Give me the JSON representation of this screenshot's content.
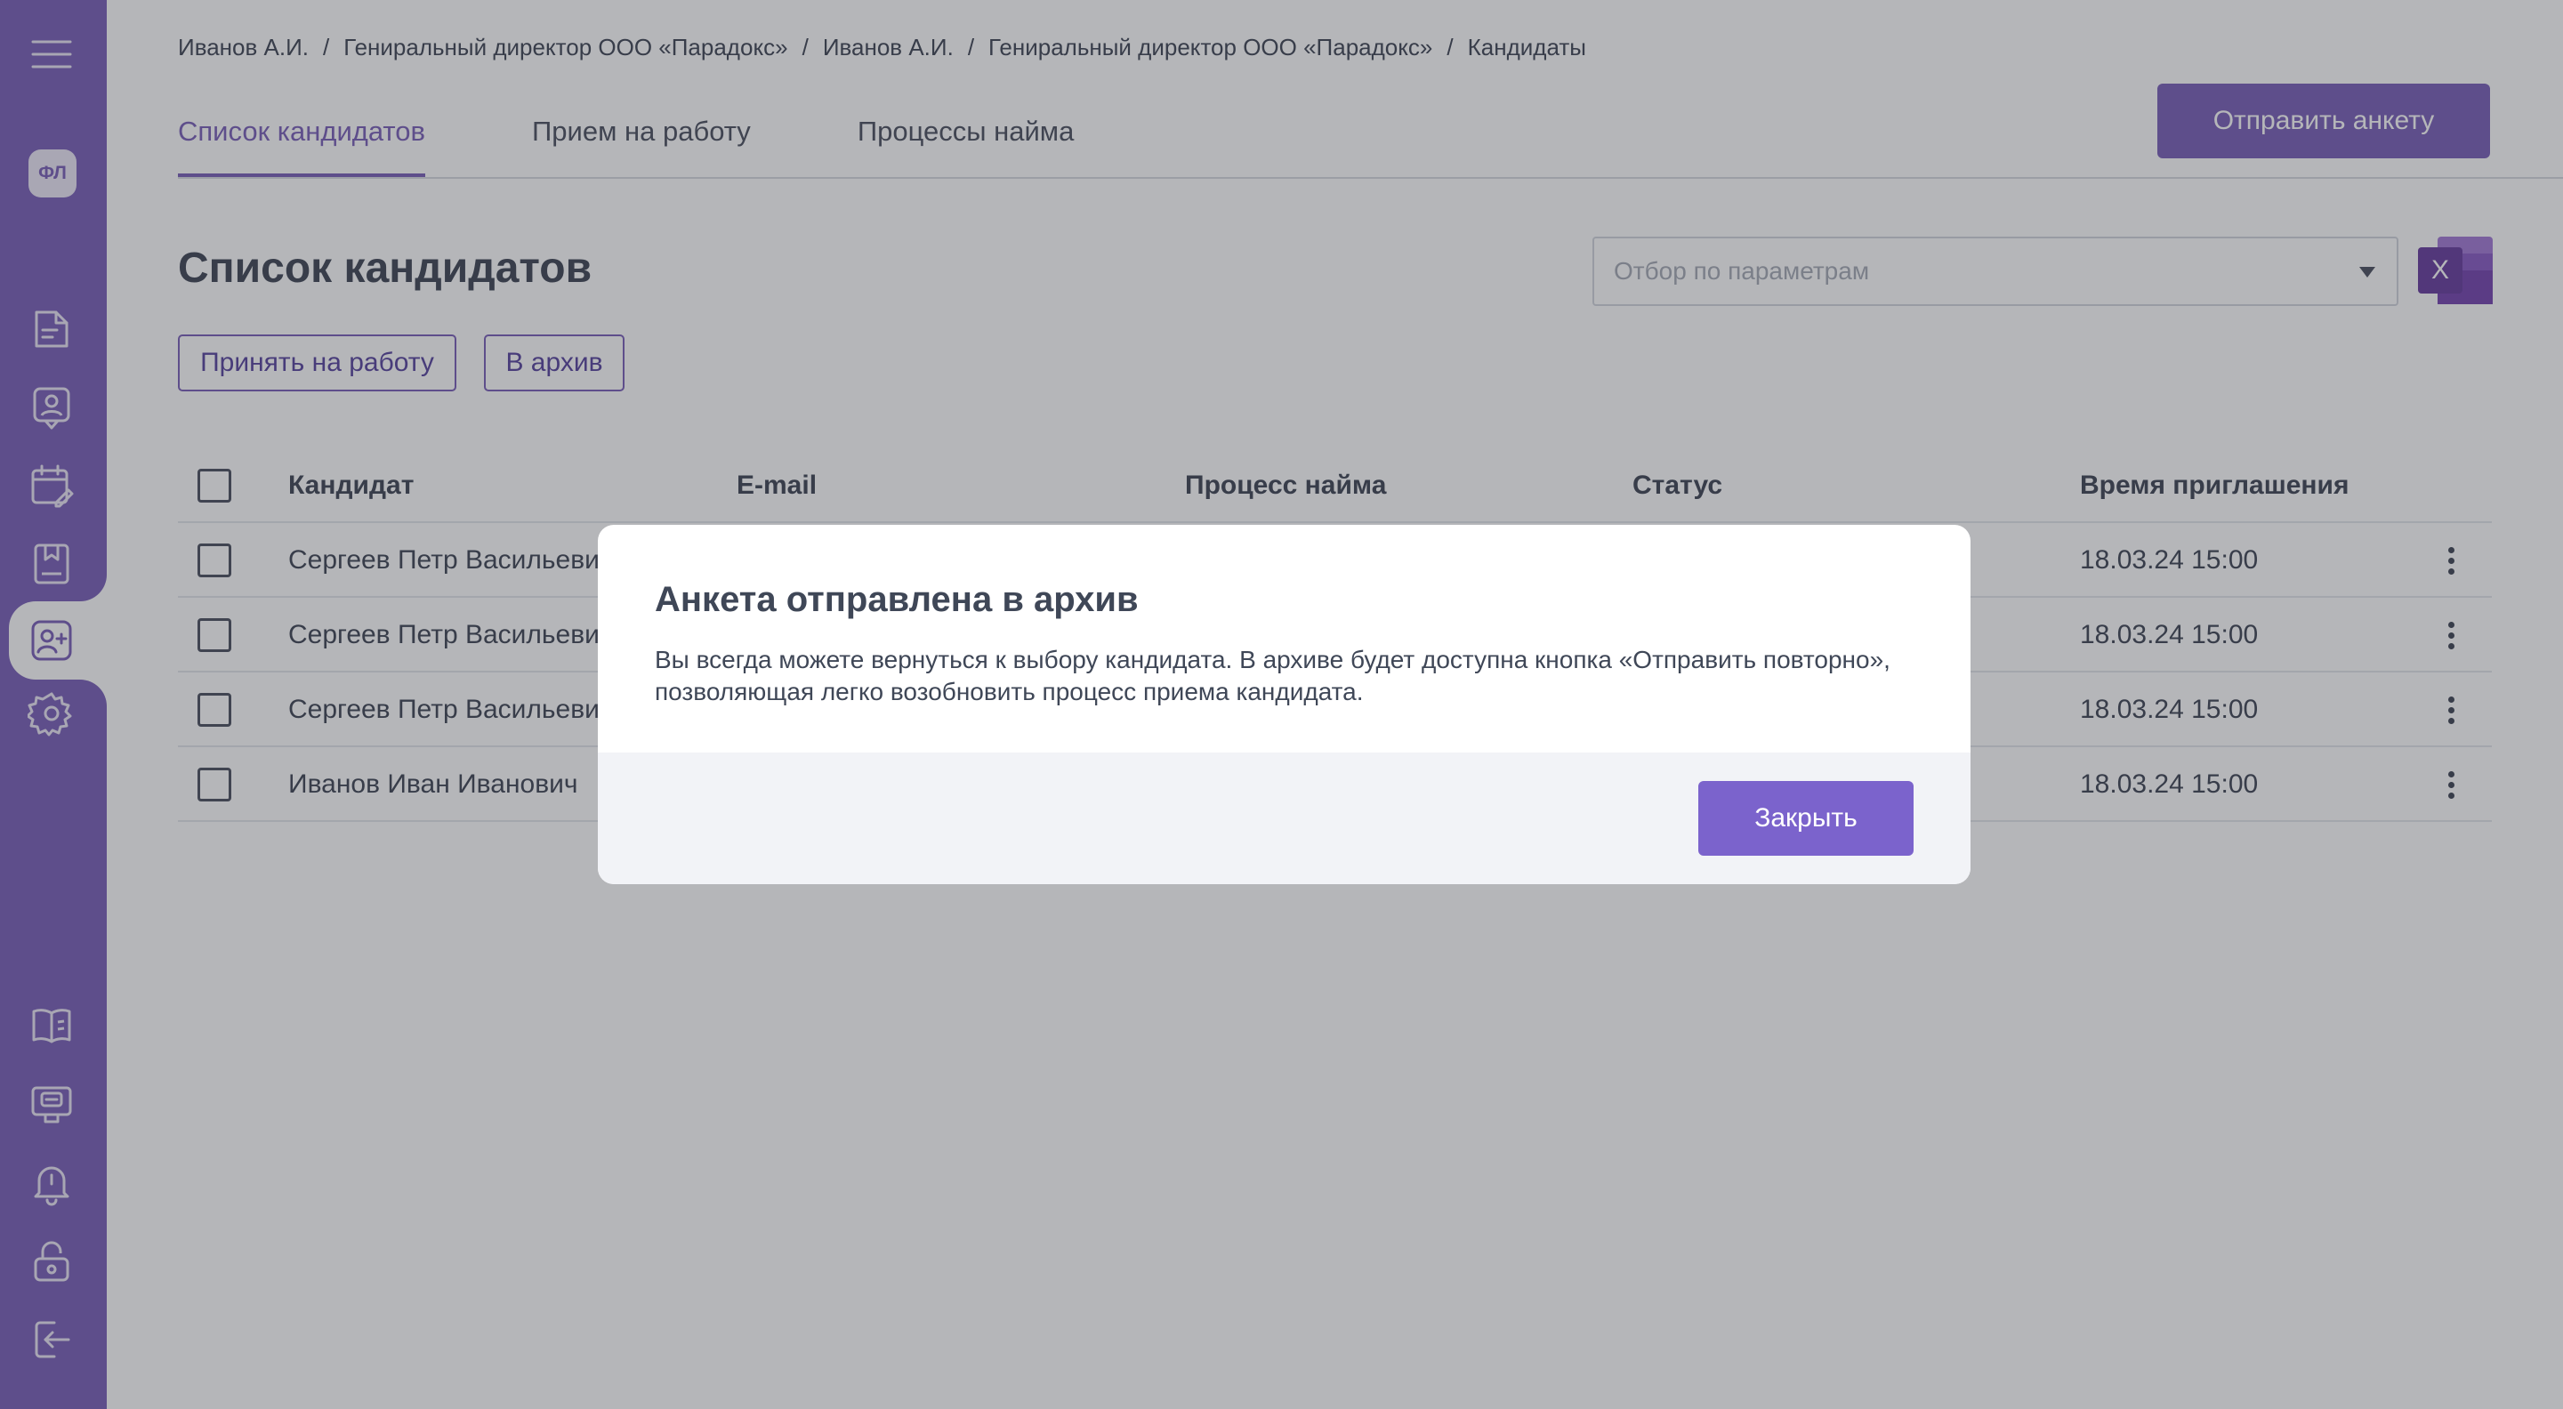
{
  "sidebar": {
    "avatar_initials": "ФЛ",
    "items": [
      {
        "icon": "menu-icon"
      },
      {
        "icon": "document-icon"
      },
      {
        "icon": "user-badge-icon"
      },
      {
        "icon": "calendar-edit-icon"
      },
      {
        "icon": "bookmark-book-icon"
      },
      {
        "icon": "add-user-icon",
        "active": true
      },
      {
        "icon": "gear-icon"
      },
      {
        "icon": "open-book-icon"
      },
      {
        "icon": "chat-monitor-icon"
      },
      {
        "icon": "bell-icon"
      },
      {
        "icon": "lock-open-icon"
      },
      {
        "icon": "logout-icon"
      }
    ]
  },
  "breadcrumb": [
    "Иванов А.И.",
    "Гениральный директор ООО «Парадокс»",
    "Иванов А.И.",
    "Гениральный директор ООО «Парадокс»",
    "Кандидаты"
  ],
  "tabs": [
    {
      "label": "Список кандидатов",
      "active": true
    },
    {
      "label": "Прием на работу"
    },
    {
      "label": "Процессы найма"
    }
  ],
  "header": {
    "send_button": "Отправить анкету"
  },
  "page": {
    "title": "Список кандидатов",
    "filter_placeholder": "Отбор по параметрам",
    "hire_button": "Принять на работу",
    "archive_button": "В архив"
  },
  "table": {
    "columns": [
      "Кандидат",
      "E-mail",
      "Процесс найма",
      "Статус",
      "Время приглашения"
    ],
    "rows": [
      {
        "name": "Сергеев Петр Васильеви",
        "time": "18.03.24 15:00"
      },
      {
        "name": "Сергеев Петр Васильеви",
        "time": "18.03.24 15:00"
      },
      {
        "name": "Сергеев Петр Васильеви",
        "time": "18.03.24 15:00"
      },
      {
        "name": "Иванов Иван Иванович",
        "time": "18.03.24 15:00"
      }
    ]
  },
  "modal": {
    "title": "Анкета отправлена в архив",
    "text": "Вы всегда можете вернуться к выбору кандидата. В архиве будет доступна кнопка «Отправить повторно», позволяющая легко возобновить процесс приема кандидата.",
    "close_button": "Закрыть"
  },
  "colors": {
    "accent": "#6f52b3",
    "overlay": "rgba(70,72,80,0.40)",
    "excel": "#7b3fb7"
  }
}
